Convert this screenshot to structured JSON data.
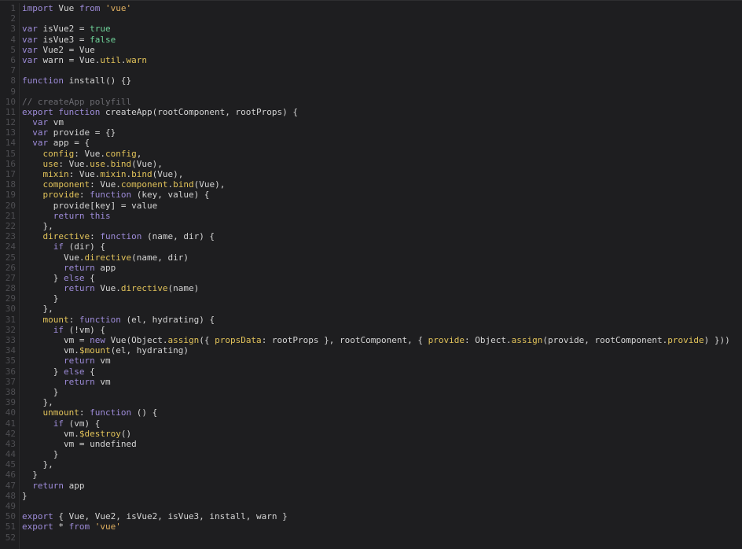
{
  "editor": {
    "colors": {
      "background": "#1e1e20",
      "keyword": "#9d8bd8",
      "string": "#e0b060",
      "boolean": "#6fd39a",
      "property": "#e2c35a",
      "comment": "#6a6a70",
      "text": "#d4d4d4",
      "line_number": "#4e4e52"
    },
    "lines": [
      [
        [
          "k",
          "import"
        ],
        [
          "t",
          " Vue "
        ],
        [
          "k",
          "from"
        ],
        [
          "t",
          " "
        ],
        [
          "s",
          "'vue'"
        ]
      ],
      [],
      [
        [
          "k",
          "var"
        ],
        [
          "t",
          " isVue2 = "
        ],
        [
          "b",
          "true"
        ]
      ],
      [
        [
          "k",
          "var"
        ],
        [
          "t",
          " isVue3 = "
        ],
        [
          "b",
          "false"
        ]
      ],
      [
        [
          "k",
          "var"
        ],
        [
          "t",
          " Vue2 = Vue"
        ]
      ],
      [
        [
          "k",
          "var"
        ],
        [
          "t",
          " warn = Vue."
        ],
        [
          "p",
          "util"
        ],
        [
          "t",
          "."
        ],
        [
          "p",
          "warn"
        ]
      ],
      [],
      [
        [
          "k",
          "function"
        ],
        [
          "t",
          " install() {}"
        ]
      ],
      [],
      [
        [
          "c",
          "// createApp polyfill"
        ]
      ],
      [
        [
          "k",
          "export"
        ],
        [
          "t",
          " "
        ],
        [
          "k",
          "function"
        ],
        [
          "t",
          " createApp(rootComponent, rootProps) {"
        ]
      ],
      [
        [
          "t",
          "  "
        ],
        [
          "k",
          "var"
        ],
        [
          "t",
          " vm"
        ]
      ],
      [
        [
          "t",
          "  "
        ],
        [
          "k",
          "var"
        ],
        [
          "t",
          " provide = {}"
        ]
      ],
      [
        [
          "t",
          "  "
        ],
        [
          "k",
          "var"
        ],
        [
          "t",
          " app = {"
        ]
      ],
      [
        [
          "t",
          "    "
        ],
        [
          "p",
          "config"
        ],
        [
          "t",
          ": Vue."
        ],
        [
          "p",
          "config"
        ],
        [
          "t",
          ","
        ]
      ],
      [
        [
          "t",
          "    "
        ],
        [
          "p",
          "use"
        ],
        [
          "t",
          ": Vue."
        ],
        [
          "p",
          "use"
        ],
        [
          "t",
          "."
        ],
        [
          "p",
          "bind"
        ],
        [
          "t",
          "(Vue),"
        ]
      ],
      [
        [
          "t",
          "    "
        ],
        [
          "p",
          "mixin"
        ],
        [
          "t",
          ": Vue."
        ],
        [
          "p",
          "mixin"
        ],
        [
          "t",
          "."
        ],
        [
          "p",
          "bind"
        ],
        [
          "t",
          "(Vue),"
        ]
      ],
      [
        [
          "t",
          "    "
        ],
        [
          "p",
          "component"
        ],
        [
          "t",
          ": Vue."
        ],
        [
          "p",
          "component"
        ],
        [
          "t",
          "."
        ],
        [
          "p",
          "bind"
        ],
        [
          "t",
          "(Vue),"
        ]
      ],
      [
        [
          "t",
          "    "
        ],
        [
          "p",
          "provide"
        ],
        [
          "t",
          ": "
        ],
        [
          "k",
          "function"
        ],
        [
          "t",
          " (key, value) {"
        ]
      ],
      [
        [
          "t",
          "      provide[key] = value"
        ]
      ],
      [
        [
          "t",
          "      "
        ],
        [
          "k",
          "return"
        ],
        [
          "t",
          " "
        ],
        [
          "k",
          "this"
        ]
      ],
      [
        [
          "t",
          "    },"
        ]
      ],
      [
        [
          "t",
          "    "
        ],
        [
          "p",
          "directive"
        ],
        [
          "t",
          ": "
        ],
        [
          "k",
          "function"
        ],
        [
          "t",
          " (name, dir) {"
        ]
      ],
      [
        [
          "t",
          "      "
        ],
        [
          "k",
          "if"
        ],
        [
          "t",
          " (dir) {"
        ]
      ],
      [
        [
          "t",
          "        Vue."
        ],
        [
          "p",
          "directive"
        ],
        [
          "t",
          "(name, dir)"
        ]
      ],
      [
        [
          "t",
          "        "
        ],
        [
          "k",
          "return"
        ],
        [
          "t",
          " app"
        ]
      ],
      [
        [
          "t",
          "      } "
        ],
        [
          "k",
          "else"
        ],
        [
          "t",
          " {"
        ]
      ],
      [
        [
          "t",
          "        "
        ],
        [
          "k",
          "return"
        ],
        [
          "t",
          " Vue."
        ],
        [
          "p",
          "directive"
        ],
        [
          "t",
          "(name)"
        ]
      ],
      [
        [
          "t",
          "      }"
        ]
      ],
      [
        [
          "t",
          "    },"
        ]
      ],
      [
        [
          "t",
          "    "
        ],
        [
          "p",
          "mount"
        ],
        [
          "t",
          ": "
        ],
        [
          "k",
          "function"
        ],
        [
          "t",
          " (el, hydrating) {"
        ]
      ],
      [
        [
          "t",
          "      "
        ],
        [
          "k",
          "if"
        ],
        [
          "t",
          " (!vm) {"
        ]
      ],
      [
        [
          "t",
          "        vm = "
        ],
        [
          "k",
          "new"
        ],
        [
          "t",
          " Vue(Object."
        ],
        [
          "p",
          "assign"
        ],
        [
          "t",
          "({ "
        ],
        [
          "p",
          "propsData"
        ],
        [
          "t",
          ": rootProps }, rootComponent, { "
        ],
        [
          "p",
          "provide"
        ],
        [
          "t",
          ": Object."
        ],
        [
          "p",
          "assign"
        ],
        [
          "t",
          "(provide, rootComponent."
        ],
        [
          "p",
          "provide"
        ],
        [
          "t",
          ") }))"
        ]
      ],
      [
        [
          "t",
          "        vm."
        ],
        [
          "p",
          "$mount"
        ],
        [
          "t",
          "(el, hydrating)"
        ]
      ],
      [
        [
          "t",
          "        "
        ],
        [
          "k",
          "return"
        ],
        [
          "t",
          " vm"
        ]
      ],
      [
        [
          "t",
          "      } "
        ],
        [
          "k",
          "else"
        ],
        [
          "t",
          " {"
        ]
      ],
      [
        [
          "t",
          "        "
        ],
        [
          "k",
          "return"
        ],
        [
          "t",
          " vm"
        ]
      ],
      [
        [
          "t",
          "      }"
        ]
      ],
      [
        [
          "t",
          "    },"
        ]
      ],
      [
        [
          "t",
          "    "
        ],
        [
          "p",
          "unmount"
        ],
        [
          "t",
          ": "
        ],
        [
          "k",
          "function"
        ],
        [
          "t",
          " () {"
        ]
      ],
      [
        [
          "t",
          "      "
        ],
        [
          "k",
          "if"
        ],
        [
          "t",
          " (vm) {"
        ]
      ],
      [
        [
          "t",
          "        vm."
        ],
        [
          "p",
          "$destroy"
        ],
        [
          "t",
          "()"
        ]
      ],
      [
        [
          "t",
          "        vm = undefined"
        ]
      ],
      [
        [
          "t",
          "      }"
        ]
      ],
      [
        [
          "t",
          "    },"
        ]
      ],
      [
        [
          "t",
          "  }"
        ]
      ],
      [
        [
          "t",
          "  "
        ],
        [
          "k",
          "return"
        ],
        [
          "t",
          " app"
        ]
      ],
      [
        [
          "t",
          "}"
        ]
      ],
      [],
      [
        [
          "k",
          "export"
        ],
        [
          "t",
          " { Vue, Vue2, isVue2, isVue3, install, warn }"
        ]
      ],
      [
        [
          "k",
          "export"
        ],
        [
          "t",
          " * "
        ],
        [
          "k",
          "from"
        ],
        [
          "t",
          " "
        ],
        [
          "s",
          "'vue'"
        ]
      ],
      []
    ]
  }
}
